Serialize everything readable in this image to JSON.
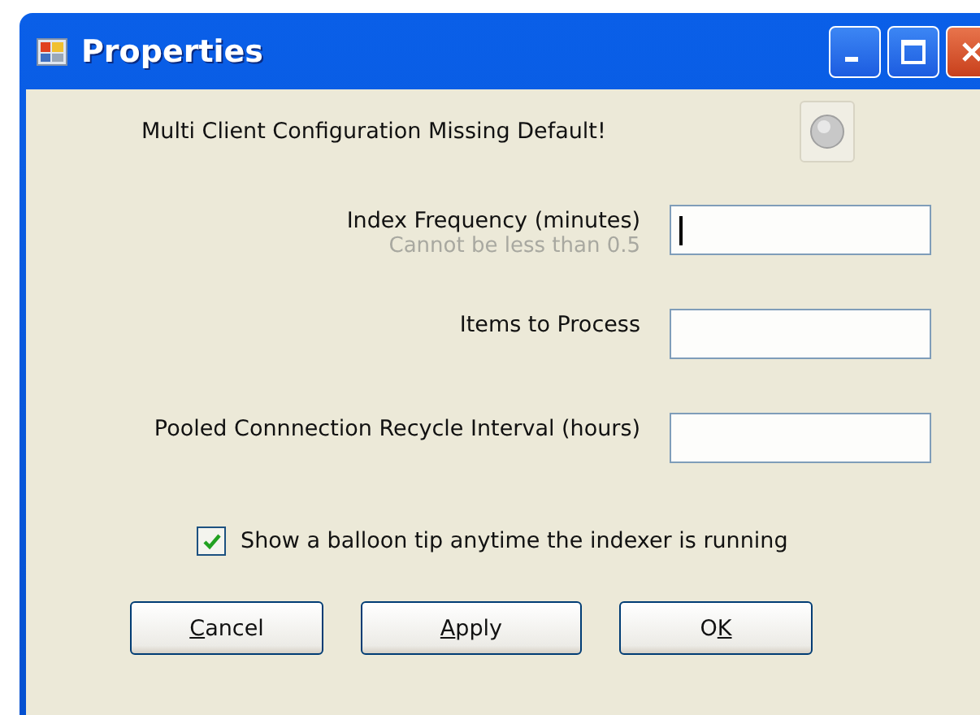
{
  "window": {
    "title": "Properties"
  },
  "status": {
    "message": "Multi Client Configuration Missing Default!",
    "button_disabled": true
  },
  "fields": [
    {
      "label": "Index Frequency (minutes)",
      "hint": "Cannot be less than 0.5",
      "focused": true
    },
    {
      "label": "Items to Process",
      "focused": false
    },
    {
      "label": "Pooled Connnection Recycle Interval (hours)",
      "focused": false
    }
  ],
  "checkbox": {
    "label": "Show a balloon tip anytime the indexer is running",
    "checked": true
  },
  "buttons": [
    {
      "access_key": "C",
      "after": "ancel"
    },
    {
      "access_key": "A",
      "after": "pply"
    },
    {
      "before": "O",
      "access_key": "K"
    }
  ]
}
